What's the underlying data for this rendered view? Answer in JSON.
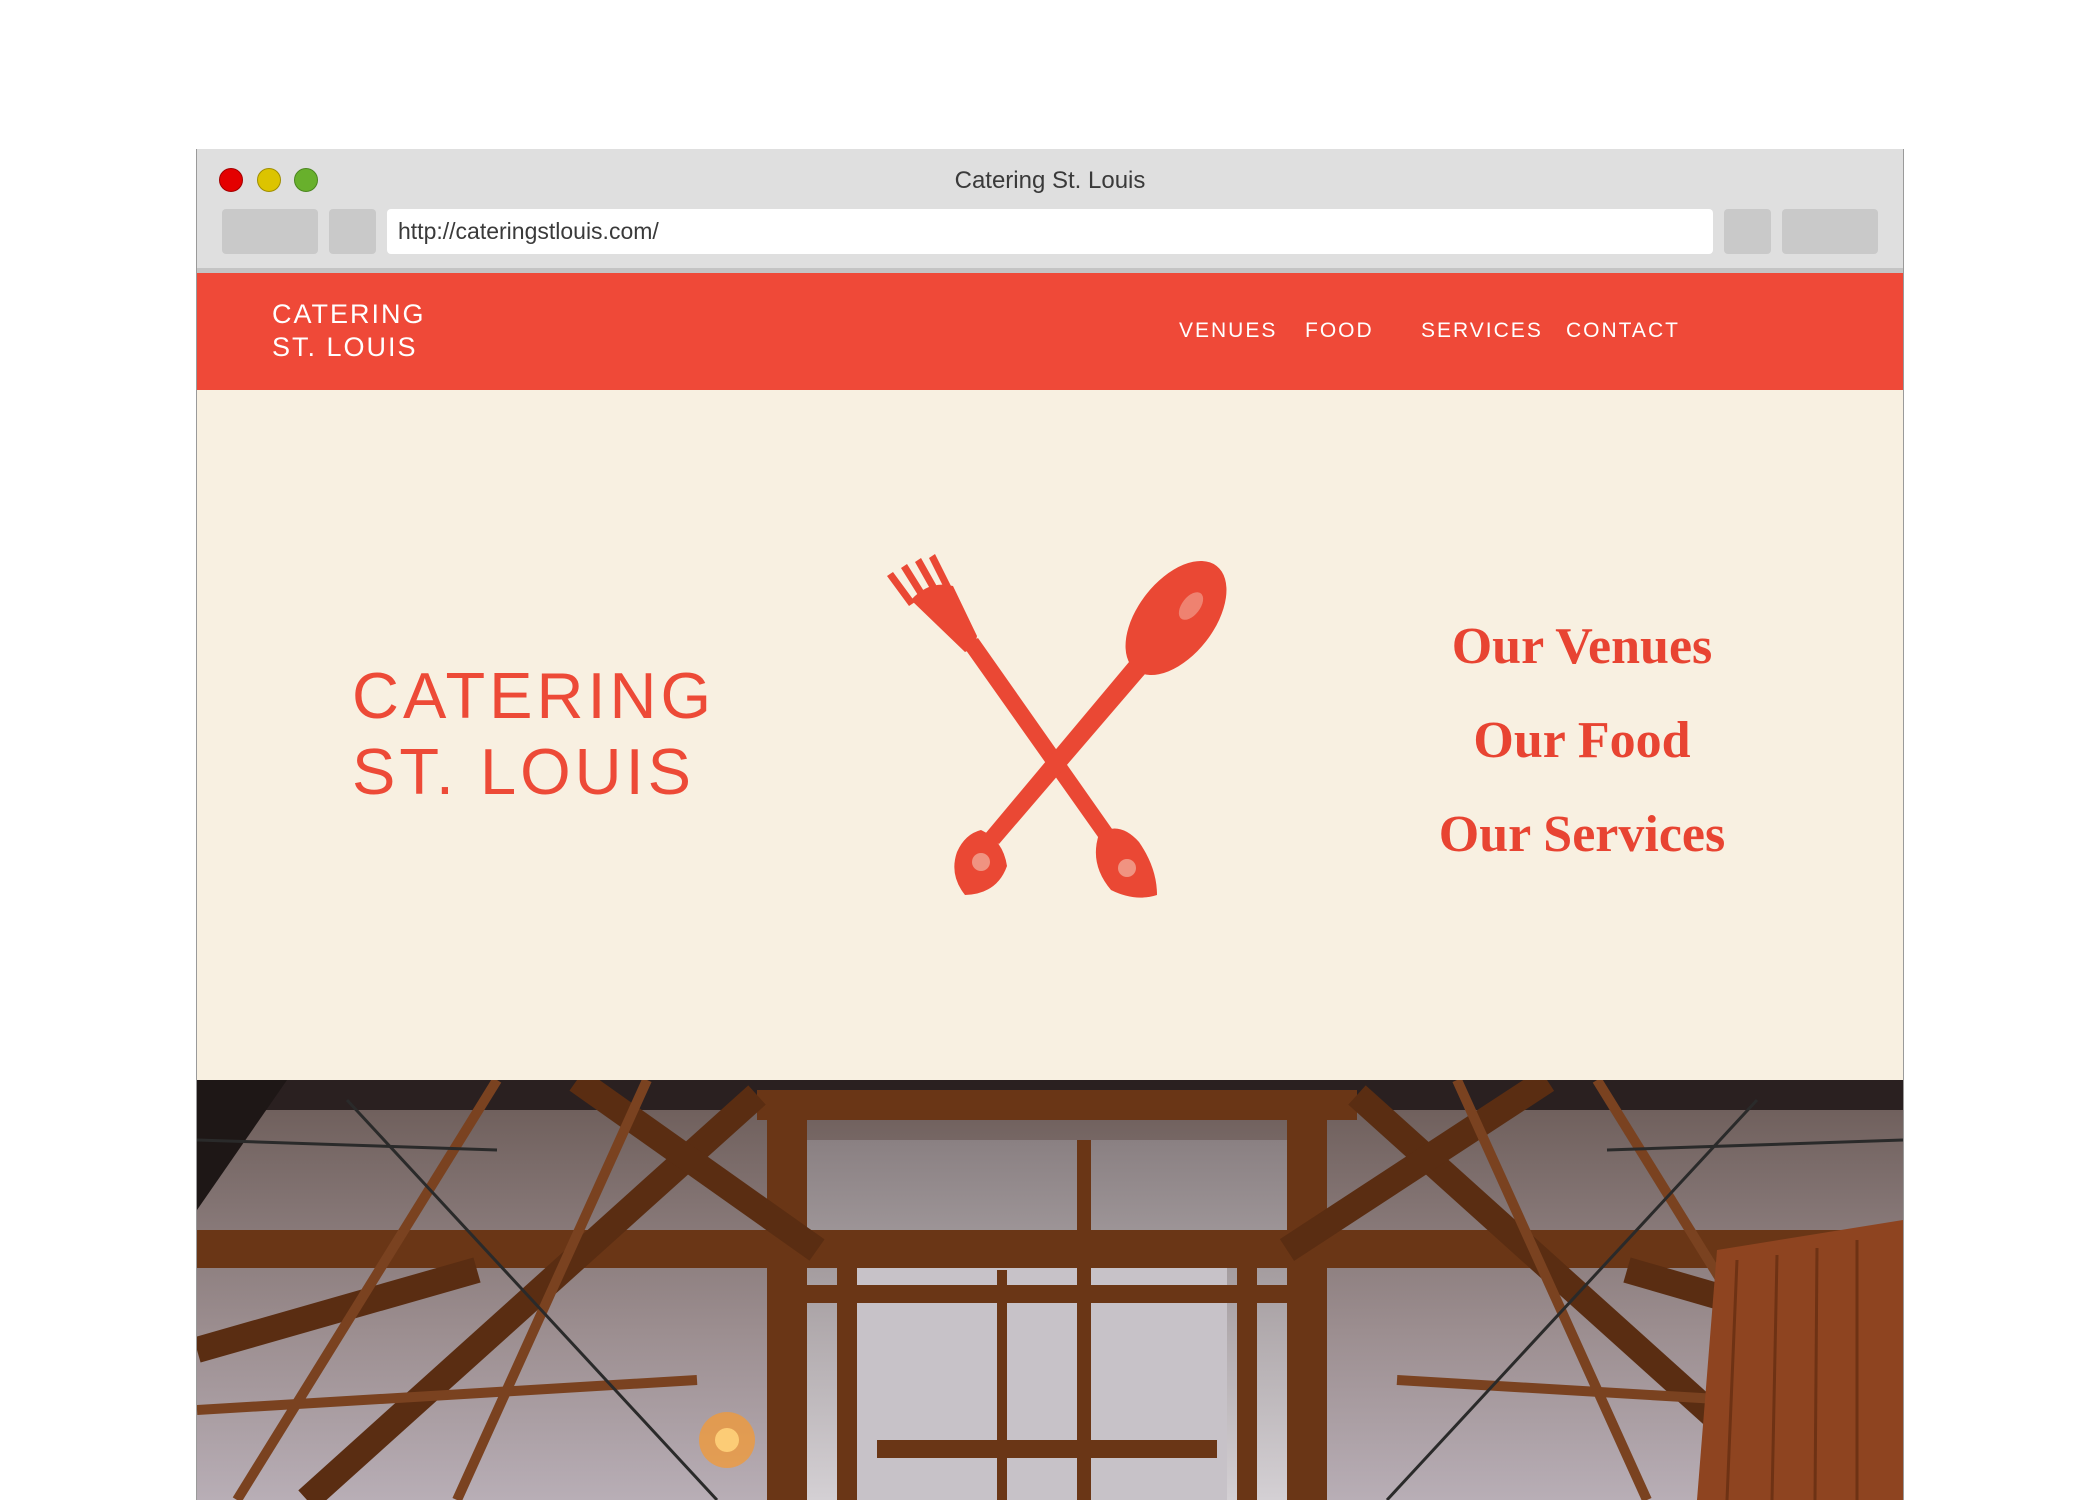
{
  "browser": {
    "title": "Catering St. Louis",
    "url": "http://cateringstlouis.com/"
  },
  "site": {
    "logo": {
      "line1": "CATERING",
      "line2": "ST. LOUIS"
    },
    "nav": [
      {
        "label": "VENUES"
      },
      {
        "label": "FOOD"
      },
      {
        "label": "SERVICES"
      },
      {
        "label": "CONTACT"
      }
    ],
    "hero": {
      "title_line1": "CATERING",
      "title_line2": "ST. LOUIS",
      "links": [
        {
          "label": "Our Venues"
        },
        {
          "label": "Our Food"
        },
        {
          "label": "Our Services"
        }
      ]
    }
  },
  "colors": {
    "brand_red": "#ef4938",
    "hero_background": "#f8f0e1",
    "browser_chrome": "#dfdfdf"
  },
  "icons": [
    "close-light",
    "minimize-light",
    "zoom-light",
    "fork-icon",
    "spoon-icon"
  ]
}
